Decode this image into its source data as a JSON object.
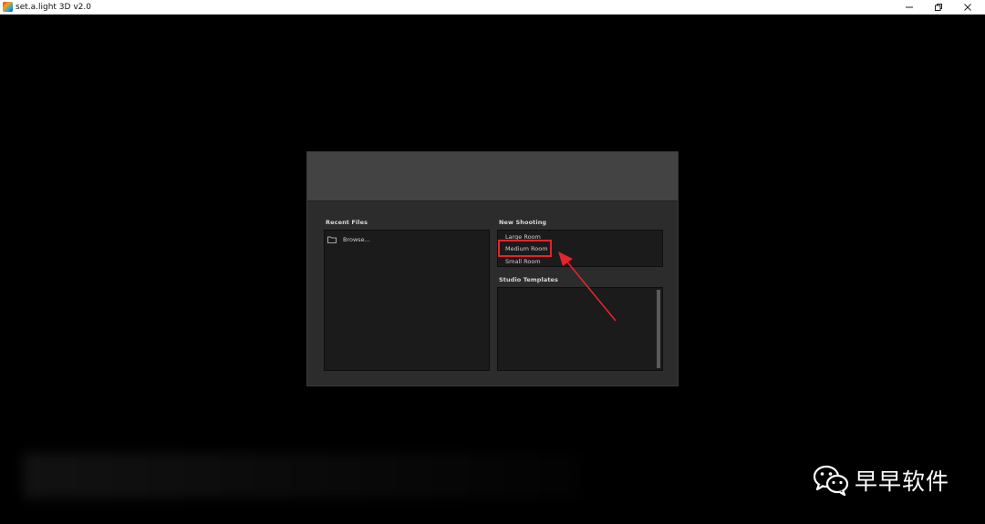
{
  "window": {
    "title": "set.a.light 3D v2.0",
    "minimize_glyph": "—",
    "restore_glyph": "❐",
    "close_glyph": "✕"
  },
  "dialog": {
    "recent_files": {
      "label": "Recent Files",
      "browse_label": "Browse..."
    },
    "new_shooting": {
      "label": "New Shooting",
      "rooms": [
        "Large Room",
        "Medium Room",
        "Small Room"
      ],
      "highlighted": "Medium Room"
    },
    "studio_templates": {
      "label": "Studio Templates"
    }
  },
  "annotation": {
    "color": "#e5242b"
  },
  "watermark": {
    "text": "早早软件"
  },
  "icons": [
    "app-icon",
    "minimize-icon",
    "restore-icon",
    "close-icon",
    "folder-icon",
    "wechat-icon"
  ]
}
